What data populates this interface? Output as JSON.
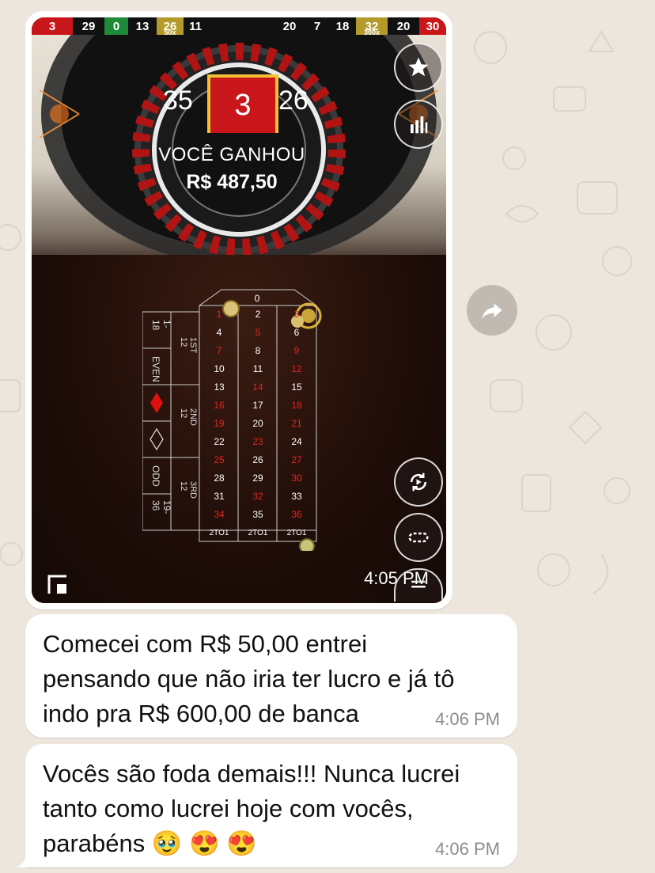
{
  "game_screenshot": {
    "result_strip": [
      {
        "num": "3",
        "color": "#c9161a"
      },
      {
        "num": "29",
        "color": "#111111"
      },
      {
        "num": "0",
        "color": "#1f8a3a"
      },
      {
        "num": "13",
        "color": "#111111"
      },
      {
        "num": "26",
        "color": "#b39a2a",
        "mult": "50x"
      },
      {
        "num": "11",
        "color": "#111111"
      },
      {
        "num": "",
        "color": "#111111"
      },
      {
        "num": "",
        "color": "#111111"
      },
      {
        "num": "20",
        "color": "#111111"
      },
      {
        "num": "7",
        "color": "#111111"
      },
      {
        "num": "18",
        "color": "#111111"
      },
      {
        "num": "32",
        "color": "#b39a2a",
        "mult": "300x"
      },
      {
        "num": "20",
        "color": "#111111"
      },
      {
        "num": "30",
        "color": "#c9161a"
      }
    ],
    "winning_number": "3",
    "left_neighbor": "35",
    "right_neighbor": "26",
    "win_text": "VOCÊ GANHOU",
    "win_amount": "R$ 487,50",
    "table": {
      "zero": "0",
      "rows": [
        [
          "1",
          "2",
          "3"
        ],
        [
          "4",
          "5",
          "6"
        ],
        [
          "7",
          "8",
          "9"
        ],
        [
          "10",
          "11",
          "12"
        ],
        [
          "13",
          "14",
          "15"
        ],
        [
          "16",
          "17",
          "18"
        ],
        [
          "19",
          "20",
          "21"
        ],
        [
          "22",
          "23",
          "24"
        ],
        [
          "25",
          "26",
          "27"
        ],
        [
          "28",
          "29",
          "30"
        ],
        [
          "31",
          "32",
          "33"
        ],
        [
          "34",
          "35",
          "36"
        ]
      ],
      "red_numbers": [
        "1",
        "3",
        "5",
        "7",
        "9",
        "12",
        "14",
        "16",
        "18",
        "19",
        "21",
        "23",
        "25",
        "27",
        "30",
        "32",
        "34",
        "36"
      ],
      "column_bets": [
        "2TO1",
        "2TO1",
        "2TO1"
      ],
      "dozens": [
        "1ST 12",
        "2ND 12",
        "3RD 12"
      ],
      "outside": [
        "1-18",
        "EVEN",
        "ODD",
        "19-36"
      ]
    },
    "buttons": [
      "star-icon",
      "stats-icon",
      "repeat-icon",
      "chips-icon",
      "menu-icon"
    ]
  },
  "image_message_time": "4:05 PM",
  "messages": [
    {
      "lines": [
        "Comecei com R$ 50,00 entrei",
        "pensando que não iria ter lucro e já tô",
        "indo pra R$ 600,00 de banca"
      ],
      "time": "4:06 PM"
    },
    {
      "lines": [
        "Vocês são foda demais!!! Nunca lucrei",
        "tanto como lucrei hoje com vocês,",
        "parabéns 🥹 😍 😍"
      ],
      "time": "4:06 PM"
    }
  ]
}
